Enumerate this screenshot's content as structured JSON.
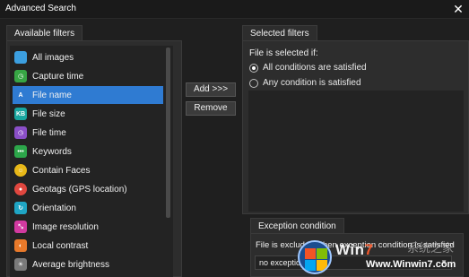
{
  "window": {
    "title": "Advanced Search",
    "close_glyph": "✕"
  },
  "available": {
    "tab_label": "Available filters",
    "items": [
      {
        "label": "All images",
        "icon": "all-images-icon",
        "color": "#3c9fe0",
        "glyph": ""
      },
      {
        "label": "Capture time",
        "icon": "clock-icon",
        "color": "#37a544",
        "glyph": "◷"
      },
      {
        "label": "File name",
        "icon": "file-name-icon",
        "color": "#2f7bd2",
        "glyph": "A"
      },
      {
        "label": "File size",
        "icon": "file-size-icon",
        "color": "#19a7a0",
        "glyph": "KB"
      },
      {
        "label": "File time",
        "icon": "file-time-icon",
        "color": "#8a4fc7",
        "glyph": "◷"
      },
      {
        "label": "Keywords",
        "icon": "keywords-icon",
        "color": "#2ca64a",
        "glyph": "•••"
      },
      {
        "label": "Contain Faces",
        "icon": "face-icon",
        "color": "#e8b818",
        "glyph": "☺"
      },
      {
        "label": "Geotags (GPS location)",
        "icon": "location-pin-icon",
        "color": "#e0473f",
        "glyph": "●"
      },
      {
        "label": "Orientation",
        "icon": "orientation-icon",
        "color": "#1fa5c4",
        "glyph": "↻"
      },
      {
        "label": "Image resolution",
        "icon": "resolution-icon",
        "color": "#d13aa0",
        "glyph": "⤡"
      },
      {
        "label": "Local contrast",
        "icon": "contrast-icon",
        "color": "#e8792a",
        "glyph": "◐"
      },
      {
        "label": "Average brightness",
        "icon": "brightness-icon",
        "color": "#7a7a7a",
        "glyph": "☀"
      }
    ],
    "selected_index": 2
  },
  "buttons": {
    "add_label": "Add >>>",
    "remove_label": "Remove"
  },
  "selected": {
    "tab_label": "Selected filters",
    "heading": "File is selected if:",
    "options": [
      {
        "label": "All conditions are satisfied",
        "checked": true
      },
      {
        "label": "Any condition is satisfied",
        "checked": false
      }
    ]
  },
  "exception": {
    "tab_label": "Exception condition",
    "text": "File is excluded when exception condition is satisfied",
    "select_value": "no exceptions"
  },
  "watermark": {
    "brand_prefix": "Win",
    "brand_seven": "7",
    "faint_text": "系统之家",
    "url": "Www.Winwin7.com"
  }
}
